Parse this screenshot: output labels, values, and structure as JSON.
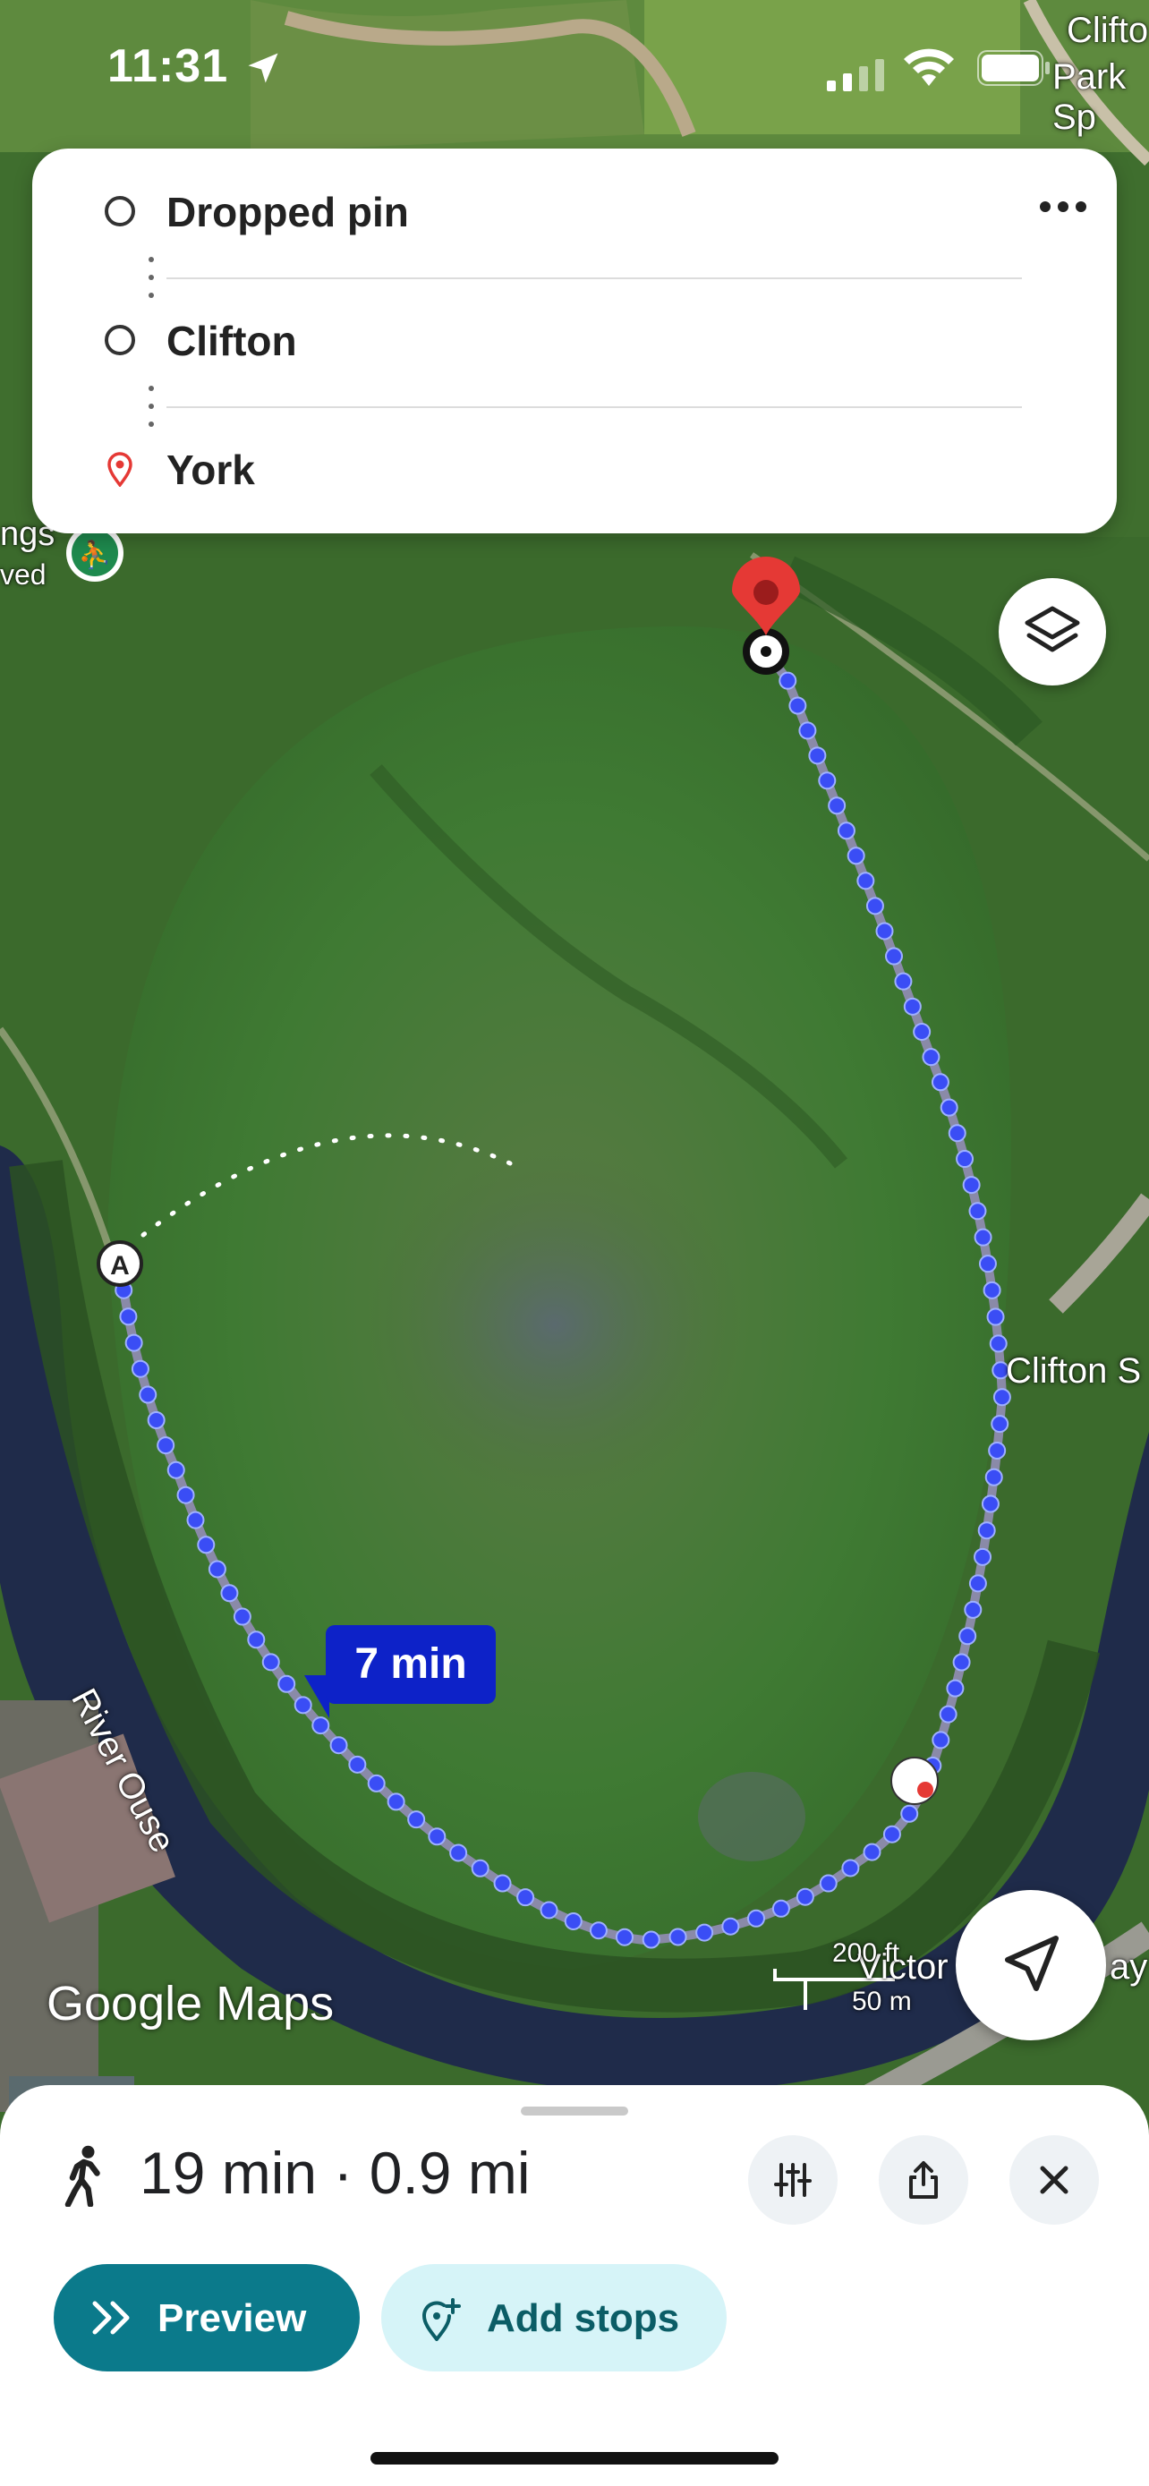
{
  "status_bar": {
    "time": "11:31",
    "icons": [
      "location-arrow-icon",
      "cellular-signal-icon",
      "wifi-icon",
      "battery-icon"
    ]
  },
  "route_card": {
    "stops": [
      {
        "label": "Dropped pin",
        "icon": "circle-outline-icon"
      },
      {
        "label": "Clifton",
        "icon": "circle-outline-icon"
      },
      {
        "label": "York",
        "icon": "red-pin-icon"
      }
    ],
    "more_icon": "more-horizontal-icon"
  },
  "map": {
    "eta_bubble": "7 min",
    "labels": {
      "river": "River Ouse",
      "clifton_s": "Clifton S",
      "clifton_park_1": "Clifto",
      "clifton_park_2": "Park Sp",
      "victor": "Victor",
      "ay": "ay",
      "ngs": "ngs",
      "ved": "ved"
    },
    "start_marker": "A",
    "scale": {
      "ft": "200 ft",
      "m": "50 m"
    },
    "watermark": "Google Maps",
    "colors": {
      "route": "#3a4df5",
      "pin": "#e53935"
    }
  },
  "bottom_sheet": {
    "summary": "19 min · 0.9 mi",
    "preview_label": "Preview",
    "add_stops_label": "Add stops",
    "icons": [
      "walking-icon",
      "filter-sliders-icon",
      "share-icon",
      "close-icon"
    ],
    "colors": {
      "preview_bg": "#0b7a8b",
      "add_stops_bg": "#d6f4f8"
    }
  }
}
